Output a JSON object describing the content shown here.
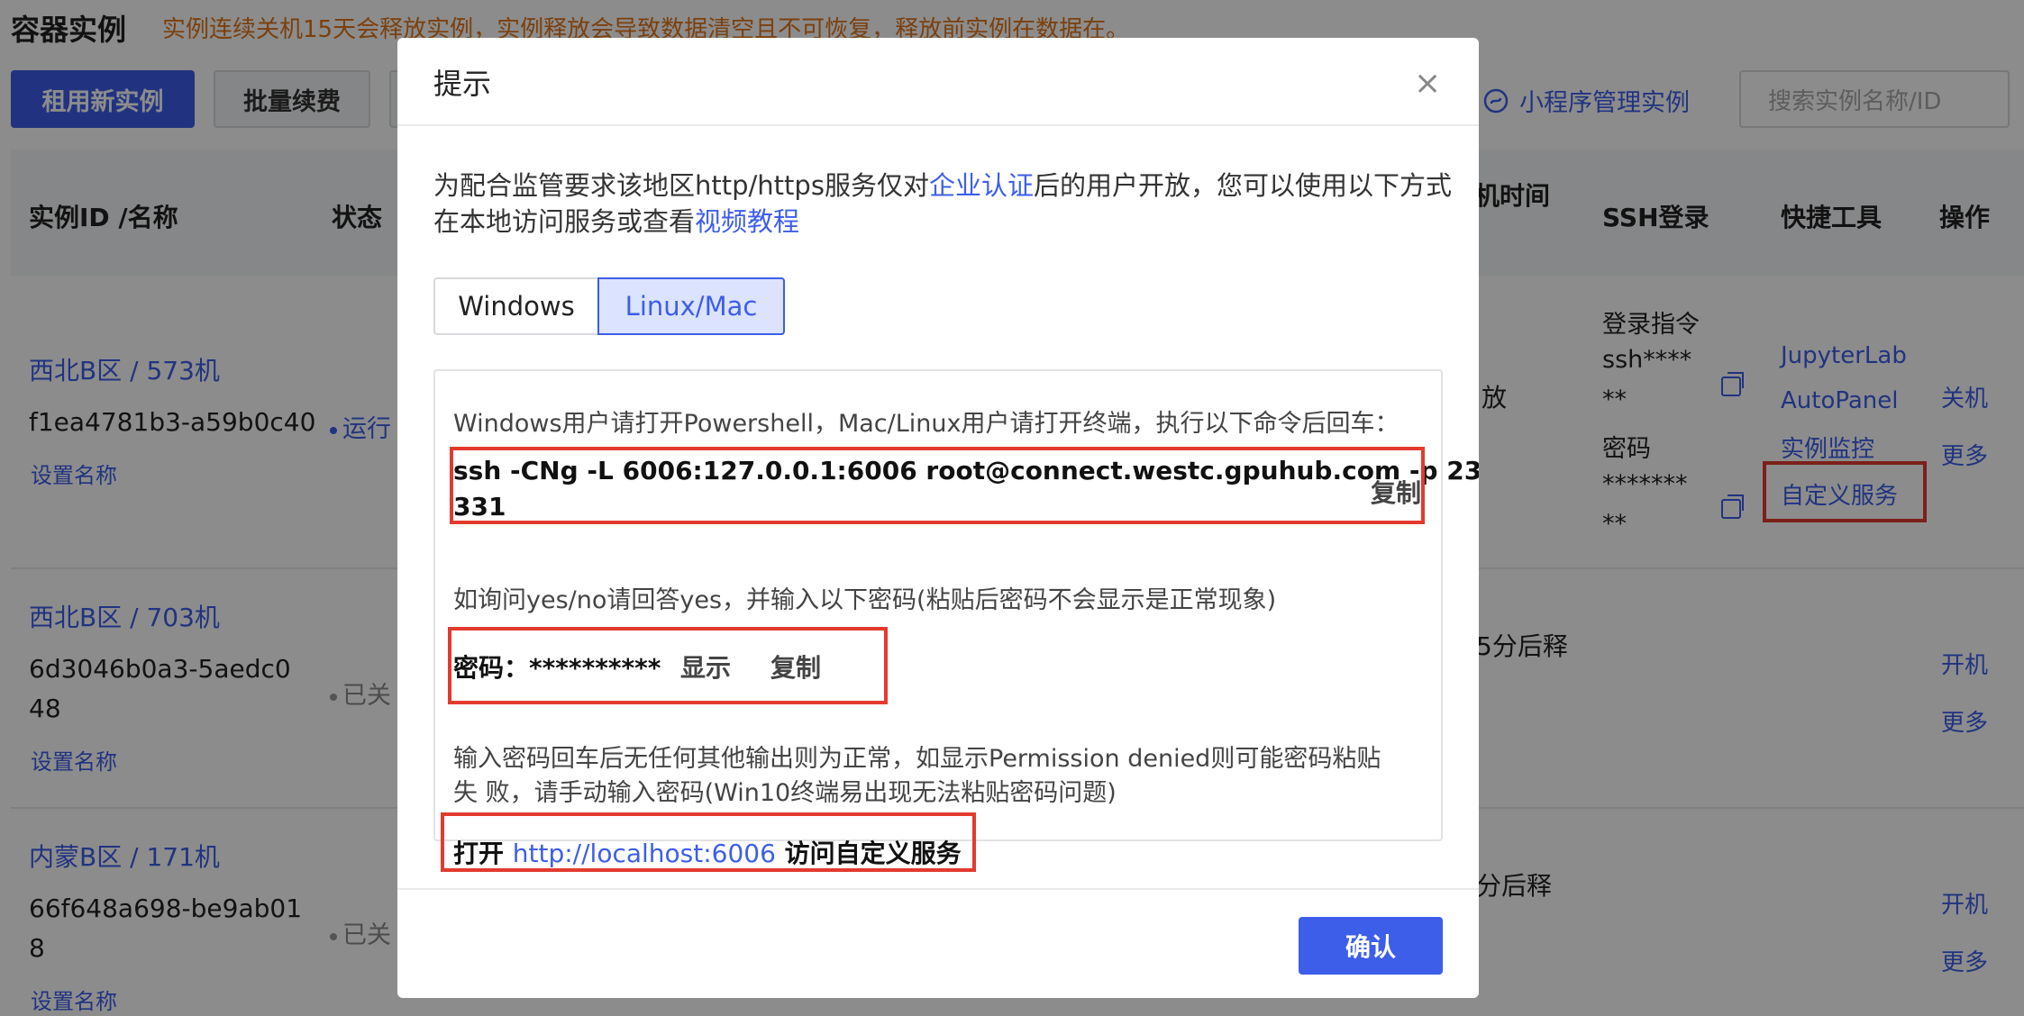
{
  "page": {
    "title": "容器实例",
    "warning": "实例连续关机15天会释放实例，实例释放会导致数据清空且不可恢复，释放前实例在数据在。",
    "new_instance_button": "租用新实例",
    "batch_renew_button": "批量续费",
    "mini_program_link": "小程序管理实例",
    "search_placeholder": "搜索实例名称/ID"
  },
  "table": {
    "headers": {
      "instance": "实例ID /名称",
      "status": "状态",
      "time": "机时间",
      "ssh": "SSH登录",
      "tools": "快捷工具",
      "ops": "操作"
    },
    "rows": [
      {
        "region": "西北B区 / 573机",
        "id": "f1ea4781b3-a59b0c40",
        "set_name": "设置名称",
        "status": "运行",
        "time": "放",
        "ssh_cmd_label": "登录指令",
        "ssh_cmd_value_1": "ssh****",
        "ssh_cmd_value_2": "**",
        "ssh_pwd_label": "密码",
        "ssh_pwd_value_1": "*******",
        "ssh_pwd_value_2": "**",
        "tools": [
          "JupyterLab",
          "AutoPanel",
          "实例监控",
          "自定义服务"
        ],
        "op_1": "关机",
        "op_2": "更多"
      },
      {
        "region": "西北B区 / 703机",
        "id_1": "6d3046b0a3-5aedc0",
        "id_2": "48",
        "set_name": "设置名称",
        "status": "已关",
        "time": "5分后释",
        "op_1": "开机",
        "op_2": "更多"
      },
      {
        "region": "内蒙B区 / 171机",
        "id_1": "66f648a698-be9ab01",
        "id_2": "8",
        "set_name": "设置名称",
        "status": "已关",
        "time": "分后释",
        "op_1": "开机",
        "op_2": "更多"
      }
    ]
  },
  "modal": {
    "title": "提示",
    "close": "×",
    "intro_1": "为配合监管要求该地区http/https服务仅对",
    "intro_link_1": "企业认证",
    "intro_2": "后的用户开放，您可以使用以下方式在本地访问服务或查看",
    "intro_link_2": "视频教程",
    "tab_windows": "Windows",
    "tab_linux": "Linux/Mac",
    "instruction": "Windows用户请打开Powershell，Mac/Linux用户请打开终端，执行以下命令后回车：",
    "command_line_1": "ssh -CNg -L 6006:127.0.0.1:6006 root@connect.westc.gpuhub.com -p 23",
    "command_line_2": "331",
    "copy": "复制",
    "yes_no_hint": "如询问yes/no请回答yes，并输入以下密码(粘贴后密码不会显示是正常现象)",
    "password_label": "密码：**********",
    "show": "显示",
    "password_copy": "复制",
    "note_line_1": "输入密码回车后无任何其他输出则为正常，如显示Permission denied则可能密码粘贴",
    "note_line_2": "失 败，请手动输入密码(Win10终端易出现无法粘贴密码问题)",
    "open_prefix": "打开",
    "open_link": "http://localhost:6006",
    "open_suffix": "访问自定义服务",
    "confirm": "确认"
  },
  "colors": {
    "accent": "#3d5ee9",
    "warning": "#e0761b",
    "highlight": "#e23b2e"
  }
}
